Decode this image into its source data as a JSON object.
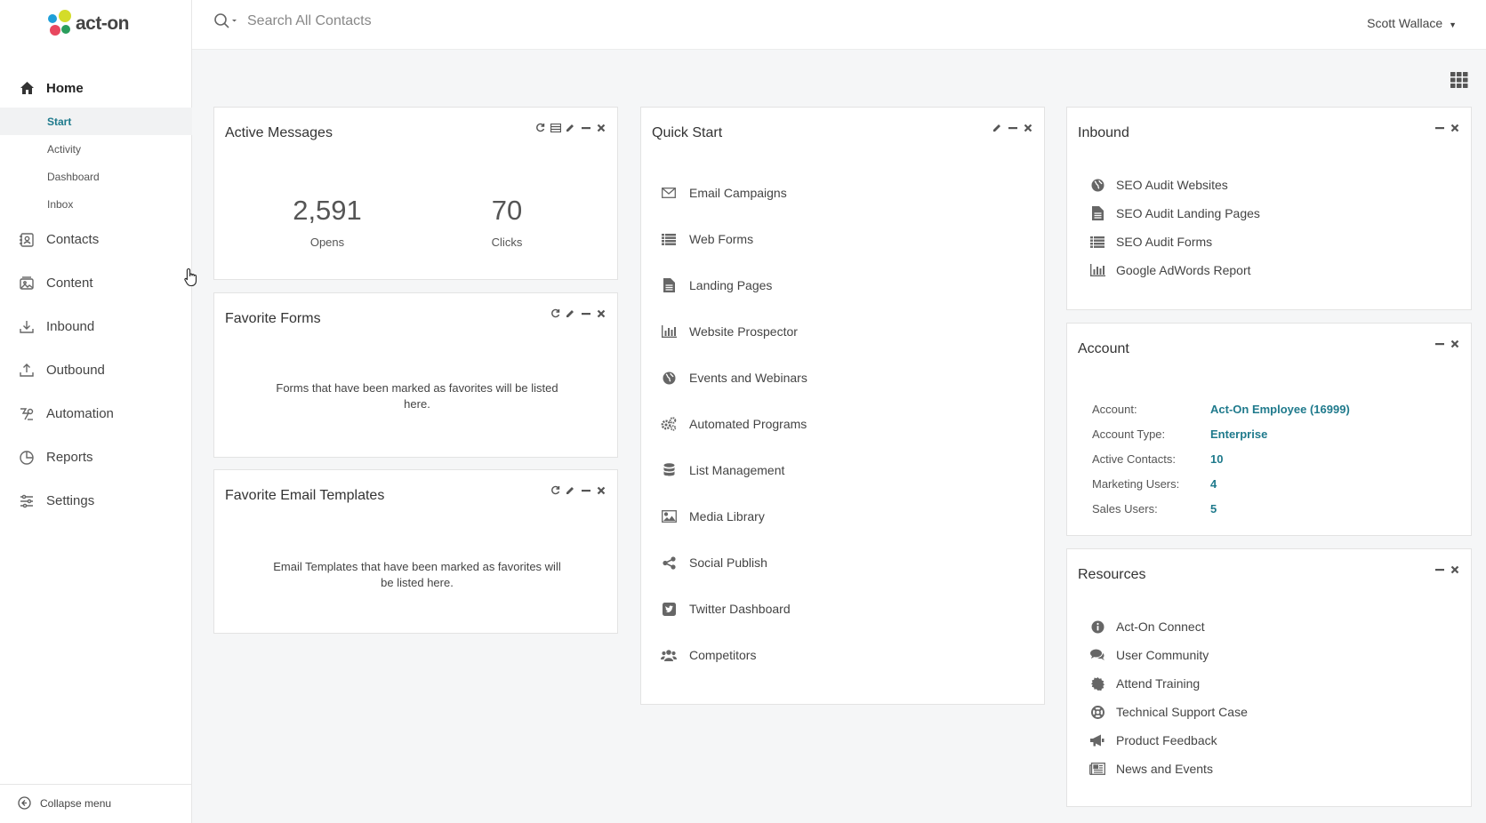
{
  "brand": {
    "name": "act-on"
  },
  "sidebar": {
    "home": "Home",
    "sub_items": [
      {
        "label": "Start",
        "active": true
      },
      {
        "label": "Activity"
      },
      {
        "label": "Dashboard"
      },
      {
        "label": "Inbox"
      }
    ],
    "items": [
      {
        "label": "Contacts",
        "icon": "contacts-icon"
      },
      {
        "label": "Content",
        "icon": "content-icon"
      },
      {
        "label": "Inbound",
        "icon": "inbound-icon"
      },
      {
        "label": "Outbound",
        "icon": "outbound-icon"
      },
      {
        "label": "Automation",
        "icon": "automation-icon"
      },
      {
        "label": "Reports",
        "icon": "reports-icon"
      },
      {
        "label": "Settings",
        "icon": "settings-icon"
      }
    ],
    "collapse": "Collapse menu"
  },
  "topbar": {
    "search_placeholder": "Search All Contacts",
    "user": "Scott Wallace"
  },
  "active_messages": {
    "title": "Active Messages",
    "opens_value": "2,591",
    "opens_label": "Opens",
    "clicks_value": "70",
    "clicks_label": "Clicks"
  },
  "favorite_forms": {
    "title": "Favorite Forms",
    "message": "Forms that have been marked as favorites will be listed here."
  },
  "favorite_templates": {
    "title": "Favorite Email Templates",
    "message": "Email Templates that have been marked as favorites will be listed here."
  },
  "quick_start": {
    "title": "Quick Start",
    "items": [
      {
        "label": "Email Campaigns",
        "icon": "envelope-icon"
      },
      {
        "label": "Web Forms",
        "icon": "list-icon"
      },
      {
        "label": "Landing Pages",
        "icon": "document-icon"
      },
      {
        "label": "Website Prospector",
        "icon": "bar-chart-icon"
      },
      {
        "label": "Events and Webinars",
        "icon": "globe-icon"
      },
      {
        "label": "Automated Programs",
        "icon": "gears-icon"
      },
      {
        "label": "List Management",
        "icon": "database-icon"
      },
      {
        "label": "Media Library",
        "icon": "image-icon"
      },
      {
        "label": "Social Publish",
        "icon": "share-icon"
      },
      {
        "label": "Twitter Dashboard",
        "icon": "twitter-icon"
      },
      {
        "label": "Competitors",
        "icon": "users-icon"
      }
    ]
  },
  "inbound": {
    "title": "Inbound",
    "items": [
      {
        "label": "SEO Audit Websites",
        "icon": "globe-icon"
      },
      {
        "label": "SEO Audit Landing Pages",
        "icon": "document-icon"
      },
      {
        "label": "SEO Audit Forms",
        "icon": "list-icon"
      },
      {
        "label": "Google AdWords Report",
        "icon": "bar-chart-icon"
      }
    ]
  },
  "account": {
    "title": "Account",
    "rows": [
      {
        "key": "Account:",
        "value": "Act-On Employee (16999)"
      },
      {
        "key": "Account Type:",
        "value": "Enterprise"
      },
      {
        "key": "Active Contacts:",
        "value": "10"
      },
      {
        "key": "Marketing Users:",
        "value": "4"
      },
      {
        "key": "Sales Users:",
        "value": "5"
      }
    ]
  },
  "resources": {
    "title": "Resources",
    "items": [
      {
        "label": "Act-On Connect",
        "icon": "info-icon"
      },
      {
        "label": "User Community",
        "icon": "comments-icon"
      },
      {
        "label": "Attend Training",
        "icon": "certificate-icon"
      },
      {
        "label": "Technical Support Case",
        "icon": "lifebuoy-icon"
      },
      {
        "label": "Product Feedback",
        "icon": "megaphone-icon"
      },
      {
        "label": "News and Events",
        "icon": "newspaper-icon"
      }
    ]
  }
}
